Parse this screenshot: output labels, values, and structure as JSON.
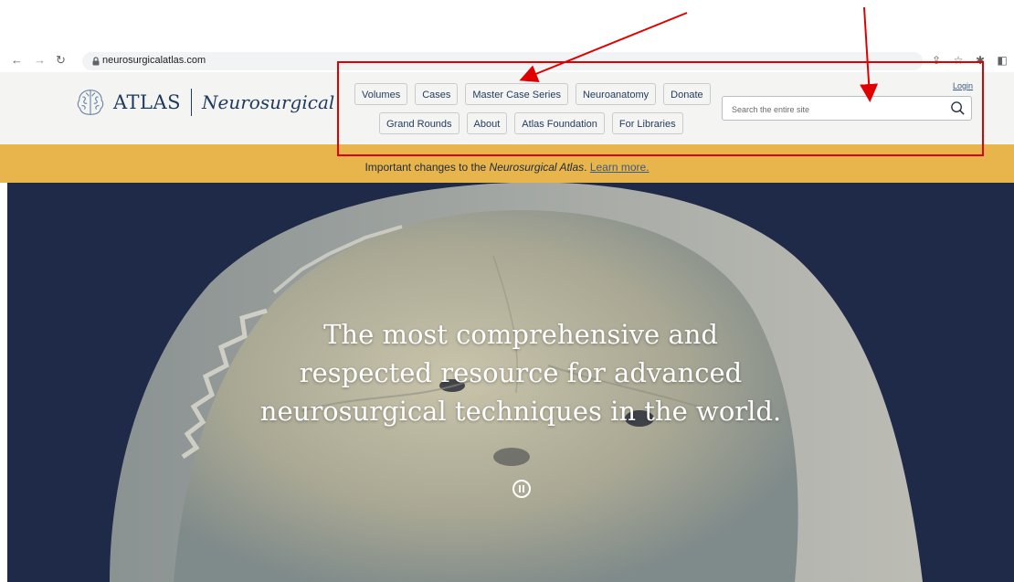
{
  "browser": {
    "url": "neurosurgicalatlas.com"
  },
  "header": {
    "logo_atlas": "ATLAS",
    "logo_neuro": "Neurosurgical",
    "login_label": "Login",
    "search_placeholder": "Search the entire site",
    "nav_row1": [
      "Volumes",
      "Cases",
      "Master Case Series",
      "Neuroanatomy",
      "Donate"
    ],
    "nav_row2": [
      "Grand Rounds",
      "About",
      "Atlas Foundation",
      "For Libraries"
    ]
  },
  "banner": {
    "prefix": "Important changes to the ",
    "italic": "Neurosurgical Atlas",
    "suffix": ". ",
    "link": "Learn more."
  },
  "hero": {
    "line1": "The most comprehensive and",
    "line2": "respected resource for advanced",
    "line3": "neurosurgical techniques in the world."
  },
  "colors": {
    "brand_navy": "#1f3a5f",
    "banner_gold": "#e8b44c",
    "hero_bg": "#1e2a47",
    "annotation_red": "#e00000"
  }
}
